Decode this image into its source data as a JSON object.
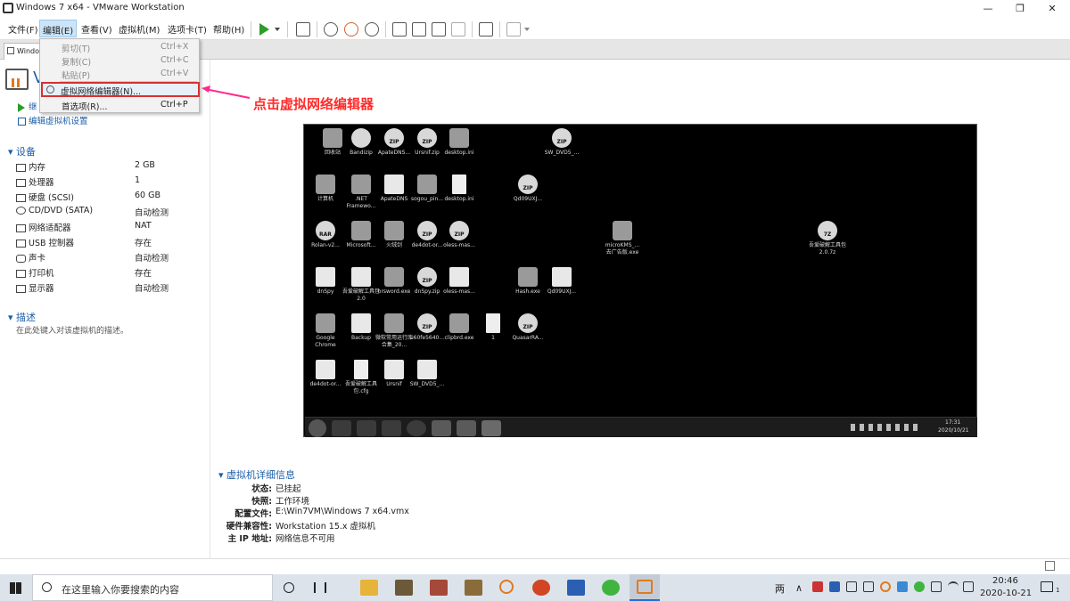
{
  "window": {
    "title": "Windows 7 x64 - VMware Workstation"
  },
  "menubar": {
    "items": [
      "文件(F)",
      "编辑(E)",
      "查看(V)",
      "虚拟机(M)",
      "选项卡(T)",
      "帮助(H)"
    ]
  },
  "tab": {
    "label": "Windo"
  },
  "vm": {
    "title_initial": "V",
    "action_start": "继",
    "action_edit": "编辑虚拟机设置"
  },
  "devices": {
    "header": "设备",
    "rows": [
      {
        "name": "内存",
        "value": "2 GB"
      },
      {
        "name": "处理器",
        "value": "1"
      },
      {
        "name": "硬盘 (SCSI)",
        "value": "60 GB"
      },
      {
        "name": "CD/DVD (SATA)",
        "value": "自动检测"
      },
      {
        "name": "网络适配器",
        "value": "NAT"
      },
      {
        "name": "USB 控制器",
        "value": "存在"
      },
      {
        "name": "声卡",
        "value": "自动检测"
      },
      {
        "name": "打印机",
        "value": "存在"
      },
      {
        "name": "显示器",
        "value": "自动检测"
      }
    ]
  },
  "description": {
    "header": "描述",
    "placeholder": "在此处键入对该虚拟机的描述。"
  },
  "edit_menu": {
    "items": [
      {
        "label": "剪切(T)",
        "shortcut": "Ctrl+X",
        "enabled": false
      },
      {
        "label": "复制(C)",
        "shortcut": "Ctrl+C",
        "enabled": false
      },
      {
        "label": "粘贴(P)",
        "shortcut": "Ctrl+V",
        "enabled": false
      },
      {
        "label": "虚拟网络编辑器(N)...",
        "shortcut": "",
        "enabled": true,
        "highlighted": true
      },
      {
        "label": "首选项(R)...",
        "shortcut": "Ctrl+P",
        "enabled": true
      }
    ]
  },
  "annotation": {
    "text": "点击虚拟网络编辑器",
    "color": "#ff2b2b"
  },
  "guest_desktop": {
    "icons": [
      {
        "label": "回收站",
        "kind": "app"
      },
      {
        "label": "Bandizip",
        "kind": "zip"
      },
      {
        "label": "ApateDNS...",
        "kind": "zip",
        "badge": "ZIP"
      },
      {
        "label": "Ursnif.zip",
        "kind": "zip",
        "badge": "ZIP"
      },
      {
        "label": "desktop.ini",
        "kind": "app"
      },
      {
        "label": "SW_DVD5_...",
        "kind": "zip",
        "badge": "ZIP"
      },
      {
        "label": "计算机",
        "kind": "app"
      },
      {
        "label": ".NET Framewo...",
        "kind": "app"
      },
      {
        "label": "ApateDNS",
        "kind": "folder"
      },
      {
        "label": "sogou_pin...",
        "kind": "app"
      },
      {
        "label": "desktop.ini",
        "kind": "file"
      },
      {
        "label": "Qd09UXJ...",
        "kind": "zip",
        "badge": "ZIP"
      },
      {
        "label": "Rolan-v2...",
        "kind": "zip",
        "badge": "RAR"
      },
      {
        "label": "Microsoft...",
        "kind": "app"
      },
      {
        "label": "火绒剑",
        "kind": "app"
      },
      {
        "label": "de4dot-or...",
        "kind": "zip",
        "badge": "ZIP"
      },
      {
        "label": "oless-mas...",
        "kind": "zip",
        "badge": "ZIP"
      },
      {
        "label": "microKMS_...去广告版.exe",
        "kind": "app"
      },
      {
        "label": "吾爱破解工具包2.0.7z",
        "kind": "zip",
        "badge": "7Z"
      },
      {
        "label": "dnSpy",
        "kind": "folder"
      },
      {
        "label": "吾爱破解工具包2.0",
        "kind": "folder"
      },
      {
        "label": "hrsword.exe",
        "kind": "app"
      },
      {
        "label": "dnSpy.zip",
        "kind": "zip",
        "badge": "ZIP"
      },
      {
        "label": "oless-mas...",
        "kind": "folder"
      },
      {
        "label": "Hash.exe",
        "kind": "app"
      },
      {
        "label": "Qd09UXJ...",
        "kind": "folder"
      },
      {
        "label": "Google Chrome",
        "kind": "app"
      },
      {
        "label": "Backup",
        "kind": "folder"
      },
      {
        "label": "微软常用运行库合集_20...",
        "kind": "app"
      },
      {
        "label": "e60fe5640...",
        "kind": "zip",
        "badge": "ZIP"
      },
      {
        "label": "clipbrd.exe",
        "kind": "app"
      },
      {
        "label": "1",
        "kind": "file"
      },
      {
        "label": "QuasarRA...",
        "kind": "zip",
        "badge": "ZIP"
      },
      {
        "label": "de4dot-or...",
        "kind": "folder"
      },
      {
        "label": "吾爱破解工具包.cfg",
        "kind": "file"
      },
      {
        "label": "Ursnif",
        "kind": "folder"
      },
      {
        "label": "SW_DVD5_...",
        "kind": "folder"
      }
    ],
    "clock_time": "17:31",
    "clock_date": "2020/10/21"
  },
  "details": {
    "header": "虚拟机详细信息",
    "rows": [
      {
        "key": "状态:",
        "value": "已挂起"
      },
      {
        "key": "快照:",
        "value": "工作环境"
      },
      {
        "key": "配置文件:",
        "value": "E:\\Win7VM\\Windows 7 x64.vmx"
      },
      {
        "key": "硬件兼容性:",
        "value": "Workstation 15.x 虚拟机"
      },
      {
        "key": "主 IP 地址:",
        "value": "网络信息不可用"
      }
    ]
  },
  "host_taskbar": {
    "search_placeholder": "在这里输入你要搜索的内容",
    "ime": "两",
    "time": "20:46",
    "date": "2020-10-21",
    "notification_count": "1"
  }
}
